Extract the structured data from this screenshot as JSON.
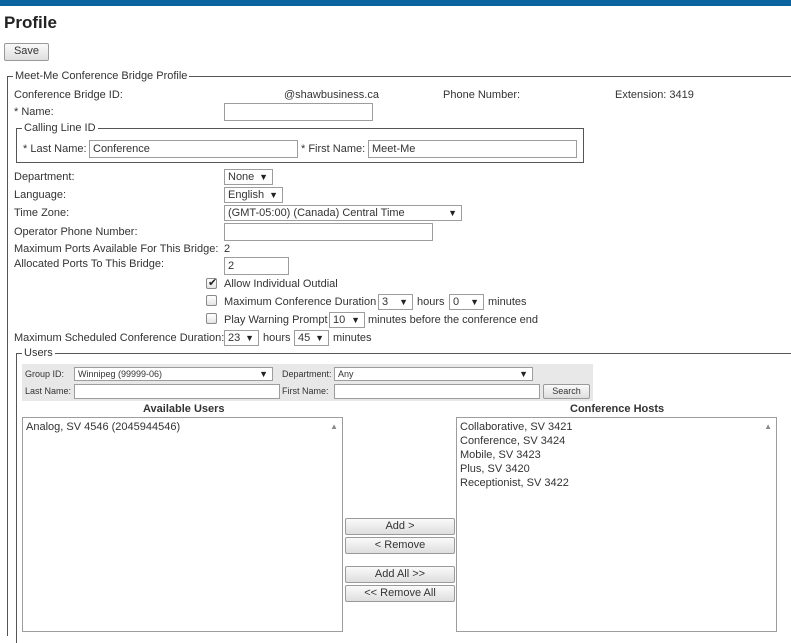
{
  "page": {
    "title": "Profile",
    "save_label": "Save"
  },
  "profile": {
    "legend": "Meet-Me Conference Bridge Profile",
    "bridge_id_label": "Conference Bridge ID:",
    "bridge_id_domain": "@shawbusiness.ca",
    "phone_number_label": "Phone Number:",
    "extension_text": "Extension: 3419",
    "name_label": "* Name:",
    "name_value": "",
    "calling_line": {
      "legend": "Calling Line ID",
      "last_name_label": "* Last Name:",
      "last_name_value": "Conference",
      "first_name_label": "* First Name:",
      "first_name_value": "Meet-Me"
    },
    "department_label": "Department:",
    "department_value": "None",
    "language_label": "Language:",
    "language_value": "English",
    "timezone_label": "Time Zone:",
    "timezone_value": "(GMT-05:00) (Canada) Central Time",
    "operator_label": "Operator Phone Number:",
    "operator_value": "",
    "max_ports_label": "Maximum Ports Available For This Bridge:",
    "max_ports_value": "2",
    "allocated_label": "Allocated Ports To This Bridge:",
    "allocated_value": "2",
    "allow_outdial_label": "Allow Individual Outdial",
    "allow_outdial_checked": true,
    "max_duration_label": "Maximum Conference Duration",
    "max_duration_checked": false,
    "max_duration_hours": "3",
    "max_duration_minutes": "0",
    "hours_label": "hours",
    "minutes_label": "minutes",
    "warning_label": "Play Warning Prompt",
    "warning_checked": false,
    "warning_minutes": "10",
    "warning_suffix": "minutes before the conference end",
    "scheduled_label": "Maximum Scheduled Conference Duration:",
    "scheduled_hours": "23",
    "scheduled_minutes": "45"
  },
  "users": {
    "legend": "Users",
    "group_id_label": "Group ID:",
    "group_id_value": "Winnipeg (99999-06)",
    "department_label": "Department:",
    "department_value": "Any",
    "last_name_label": "Last Name:",
    "first_name_label": "First Name:",
    "search_label": "Search",
    "available_header": "Available Users",
    "hosts_header": "Conference Hosts",
    "available": [
      "Analog, SV 4546 (2045944546)"
    ],
    "hosts": [
      "Collaborative, SV 3421",
      "Conference, SV 3424",
      "Mobile, SV 3423",
      "Plus, SV 3420",
      "Receptionist, SV 3422"
    ],
    "add_label": "Add >",
    "remove_label": "< Remove",
    "add_all_label": "Add All >>",
    "remove_all_label": "<< Remove All"
  },
  "icons": {
    "dropdown": "chevron-down-icon",
    "scroll_up": "scroll-up-arrow-icon",
    "check": "check-icon"
  },
  "colors": {
    "top_bar": "#0a64a0",
    "panel_bg": "#e8e8e8"
  }
}
